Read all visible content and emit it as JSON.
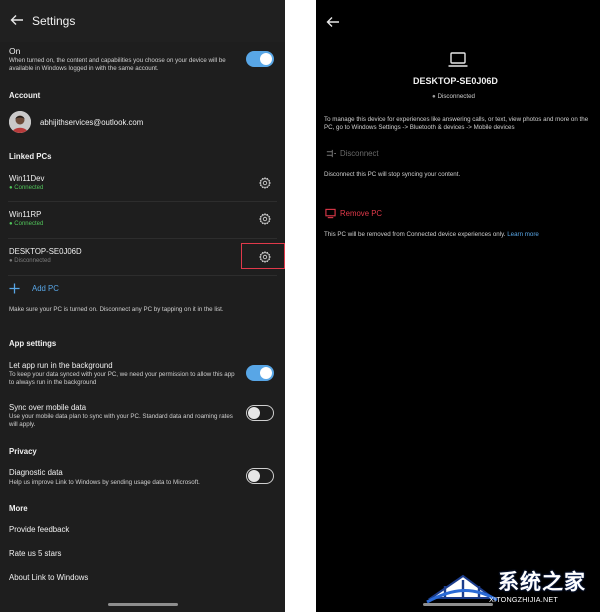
{
  "left": {
    "title": "Settings",
    "on_label": "On",
    "on_desc": "When turned on, the content and capabilities you choose on your device will be available in Windows logged in with the same account.",
    "account_header": "Account",
    "account_email": "abhijithservices@outlook.com",
    "linked_header": "Linked PCs",
    "pcs": [
      {
        "name": "Win11Dev",
        "status": "Connected"
      },
      {
        "name": "Win11RP",
        "status": "Connected"
      },
      {
        "name": "DESKTOP-SE0J06D",
        "status": "Disconnected"
      }
    ],
    "add_pc": "Add PC",
    "add_pc_note": "Make sure your PC is turned on. Disconnect any PC by tapping on it in the list.",
    "app_settings_header": "App settings",
    "bg_label": "Let app run in the background",
    "bg_desc": "To keep your data synced with your PC, we need your permission to allow this app to always run in the background",
    "mobile_label": "Sync over mobile data",
    "mobile_desc": "Use your mobile data plan to sync with your PC. Standard data and roaming rates will apply.",
    "privacy_header": "Privacy",
    "diag_label": "Diagnostic data",
    "diag_desc": "Help us improve Link to Windows by sending usage data to Microsoft.",
    "more_header": "More",
    "feedback": "Provide feedback",
    "rate": "Rate us 5 stars",
    "about": "About Link to Windows"
  },
  "right": {
    "device_name": "DESKTOP-SE0J06D",
    "status": "Disconnected",
    "description": "To manage this device for experiences like answering calls, or text, view photos and more on the PC, go to Windows Settings -> Bluetooth & devices -> Mobile devices",
    "disconnect_label": "Disconnect",
    "disconnect_note": "Disconnect this PC will stop syncing your content.",
    "remove_label": "Remove PC",
    "remove_note": "This PC will be removed from Connected device experiences only.",
    "learn_more": "Learn more"
  },
  "watermark": {
    "cn": "系统之家",
    "en": "XITONGZHIJIA.NET"
  },
  "colors": {
    "toggle_on": "#58a6e6",
    "connected": "#51c45a",
    "remove": "#e0394a",
    "link": "#5aa8e8"
  }
}
